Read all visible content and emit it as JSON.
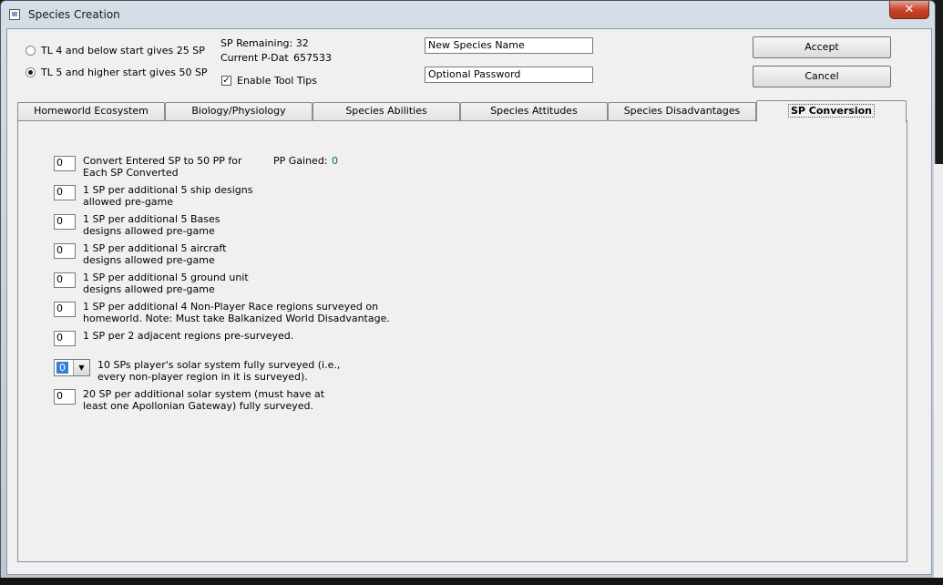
{
  "window": {
    "title": "Species Creation",
    "close_glyph": "✕"
  },
  "options": {
    "tl4_label": "TL 4 and below start gives 25 SP",
    "tl5_label": "TL 5 and higher start gives 50 SP",
    "selected": "tl5"
  },
  "status": {
    "sp_remaining": "SP Remaining: 32",
    "current_pdat_label": "Current P-Dat",
    "current_pdat_value": "657533",
    "tooltips_label": "Enable Tool Tips",
    "tooltips_checked": true
  },
  "fields": {
    "species_name": "New Species Name",
    "password": "Optional Password"
  },
  "buttons": {
    "accept": "Accept",
    "cancel": "Cancel"
  },
  "tabs": [
    {
      "label": "Homeworld Ecosystem"
    },
    {
      "label": "Biology/Physiology"
    },
    {
      "label": "Species Abilities"
    },
    {
      "label": "Species Attitudes"
    },
    {
      "label": "Species Disadvantages"
    },
    {
      "label": "SP Conversion",
      "active": true
    }
  ],
  "conversion": {
    "pp_gained_label": "PP Gained:",
    "pp_gained_value": "0",
    "pp_gained_color": "#008000",
    "rows": [
      {
        "value": "0",
        "line1": "Convert Entered SP to 50 PP for",
        "line2": "Each SP Converted"
      },
      {
        "value": "0",
        "line1": "1 SP per additional 5 ship designs",
        "line2": "allowed pre-game"
      },
      {
        "value": "0",
        "line1": "1 SP per additional 5 Bases",
        "line2": "designs allowed pre-game"
      },
      {
        "value": "0",
        "line1": "1 SP per additional 5 aircraft",
        "line2": "designs allowed pre-game"
      },
      {
        "value": "0",
        "line1": "1 SP per additional 5 ground unit",
        "line2": "designs allowed pre-game"
      },
      {
        "value": "0",
        "line1": "1 SP per additional 4 Non-Player Race regions surveyed on",
        "line2": "homeworld. Note: Must take Balkanized World Disadvantage."
      },
      {
        "value": "0",
        "line1": "1 SP per 2 adjacent regions pre-surveyed.",
        "line2": ""
      }
    ],
    "solar": {
      "value": "0",
      "line1": "10 SPs player's solar system fully surveyed (i.e.,",
      "line2": "every non-player region in it is surveyed)."
    },
    "extra": {
      "value": "0",
      "line1": "20 SP per additional solar system (must have at",
      "line2": "least one Apollonian Gateway) fully surveyed."
    }
  }
}
